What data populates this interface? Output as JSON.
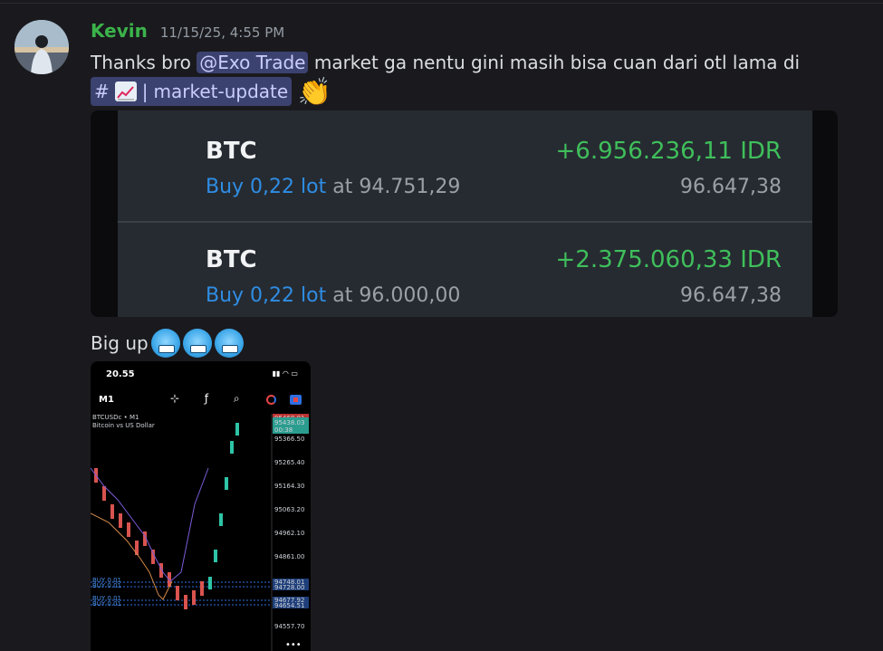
{
  "message": {
    "author": "Kevin",
    "timestamp": "11/15/25, 4:55 PM",
    "line1_before": "Thanks bro ",
    "mention": "@Exo Trade",
    "line1_after": " market ga nentu gini masih bisa cuan dari otl lama di",
    "channel_hash": "#",
    "channel_sep": "|",
    "channel_name": "market-update",
    "clap_emoji": "👏"
  },
  "embed": {
    "trades": [
      {
        "symbol": "BTC",
        "pnl": "+6.956.236,11 IDR",
        "side": "Buy 0,22 lot",
        "at_label": "at",
        "open_price": "94.751,29",
        "current_price": "96.647,38"
      },
      {
        "symbol": "BTC",
        "pnl": "+2.375.060,33 IDR",
        "side": "Buy 0,22 lot",
        "at_label": "at",
        "open_price": "96.000,00",
        "current_price": "96.647,38"
      }
    ],
    "colors": {
      "profit": "#3fbf5b",
      "buy": "#2f8de4"
    }
  },
  "message2": {
    "text": "Big up",
    "emoji_name": "cold-face"
  },
  "screenshot": {
    "time": "20.55",
    "timeframe": "M1",
    "tools": "⊹ ƒ ⌕",
    "symbol_line": "BTCUSDc • M1",
    "symbol_desc": "Bitcoin vs US Dollar",
    "price_top_red": "95468.01",
    "price_current": "95438.03",
    "price_countdown": "00:38",
    "price_axis": [
      "95366.50",
      "95265.40",
      "95164.30",
      "95063.20",
      "94962.10",
      "94861.00",
      "94557.70"
    ],
    "order_prices": [
      "94748.01",
      "94728.00",
      "94677.92",
      "94654.51"
    ],
    "order_labels": [
      "BUY 0.01",
      "BUY 0.01",
      "BUY 0.01",
      "BUY 0.01"
    ],
    "more": "•••"
  }
}
